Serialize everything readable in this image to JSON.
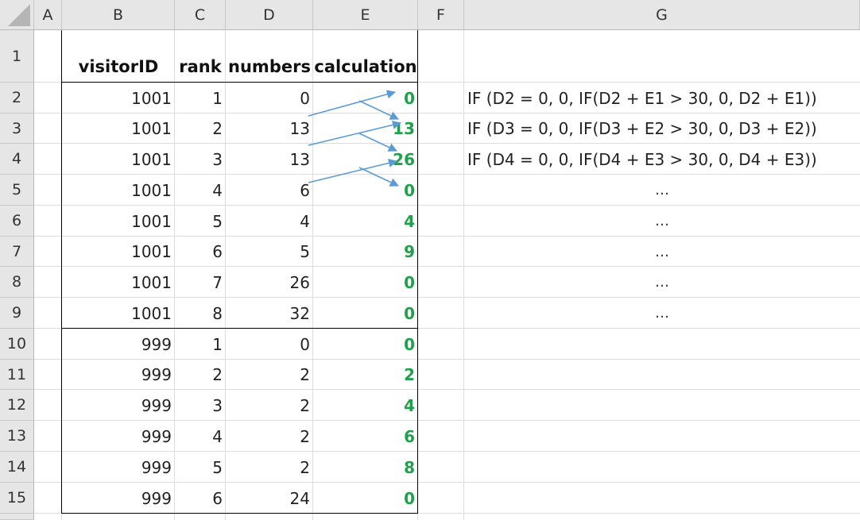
{
  "columns": [
    "A",
    "B",
    "C",
    "D",
    "E",
    "F",
    "G"
  ],
  "row_numbers": [
    "1",
    "2",
    "3",
    "4",
    "5",
    "6",
    "7",
    "8",
    "9",
    "10",
    "11",
    "12",
    "13",
    "14",
    "15"
  ],
  "header": {
    "b": "visitorID",
    "c": "rank",
    "d": "numbers",
    "e": "calculation"
  },
  "rows": [
    {
      "visitor": "1001",
      "rank": "1",
      "numbers": "0",
      "calc": "0"
    },
    {
      "visitor": "1001",
      "rank": "2",
      "numbers": "13",
      "calc": "13"
    },
    {
      "visitor": "1001",
      "rank": "3",
      "numbers": "13",
      "calc": "26"
    },
    {
      "visitor": "1001",
      "rank": "4",
      "numbers": "6",
      "calc": "0"
    },
    {
      "visitor": "1001",
      "rank": "5",
      "numbers": "4",
      "calc": "4"
    },
    {
      "visitor": "1001",
      "rank": "6",
      "numbers": "5",
      "calc": "9"
    },
    {
      "visitor": "1001",
      "rank": "7",
      "numbers": "26",
      "calc": "0"
    },
    {
      "visitor": "1001",
      "rank": "8",
      "numbers": "32",
      "calc": "0"
    },
    {
      "visitor": "999",
      "rank": "1",
      "numbers": "0",
      "calc": "0"
    },
    {
      "visitor": "999",
      "rank": "2",
      "numbers": "2",
      "calc": "2"
    },
    {
      "visitor": "999",
      "rank": "3",
      "numbers": "2",
      "calc": "4"
    },
    {
      "visitor": "999",
      "rank": "4",
      "numbers": "2",
      "calc": "6"
    },
    {
      "visitor": "999",
      "rank": "5",
      "numbers": "2",
      "calc": "8"
    },
    {
      "visitor": "999",
      "rank": "6",
      "numbers": "24",
      "calc": "0"
    }
  ],
  "notes": [
    "IF (D2 = 0, 0, IF(D2 + E1 > 30, 0, D2 + E1))",
    "IF (D3 = 0, 0, IF(D3 + E2 > 30, 0, D3 + E2))",
    "IF (D4 = 0, 0, IF(D4 + E3 > 30, 0, D4 + E3))",
    "…",
    "…",
    "…",
    "…",
    "…"
  ],
  "colors": {
    "calc_green": "#1fa04b",
    "arrow_blue": "#5b9bd5",
    "header_gray": "#e6e6e6"
  }
}
